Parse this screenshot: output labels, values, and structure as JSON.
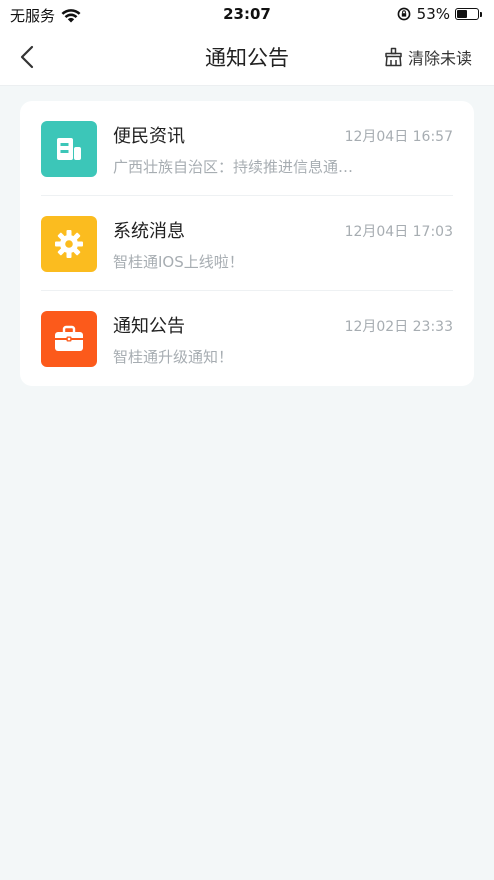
{
  "status_bar": {
    "carrier": "无服务",
    "time": "23:07",
    "battery_percent": "53%",
    "battery_level": 0.53,
    "icons": [
      "wifi-icon",
      "rotation-lock-icon",
      "battery-icon"
    ]
  },
  "nav": {
    "title": "通知公告",
    "back_icon": "chevron-left-icon",
    "clear_unread_label": "清除未读",
    "clear_unread_icon": "broom-icon"
  },
  "messages": [
    {
      "title": "便民资讯",
      "time": "12月04日 16:57",
      "preview": "广西壮族自治区：持续推进信息通…",
      "icon": "news-icon",
      "icon_color": "#3cc6b8"
    },
    {
      "title": "系统消息",
      "time": "12月04日 17:03",
      "preview": "智桂通IOS上线啦！",
      "icon": "gear-icon",
      "icon_color": "#fbbc1f"
    },
    {
      "title": "通知公告",
      "time": "12月02日 23:33",
      "preview": "智桂通升级通知！",
      "icon": "briefcase-icon",
      "icon_color": "#fc5a1b"
    }
  ]
}
